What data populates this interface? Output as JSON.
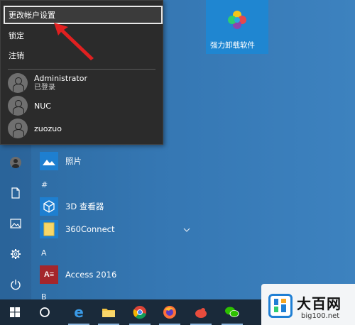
{
  "account_menu": {
    "change_account_settings": "更改帐户设置",
    "lock": "锁定",
    "sign_out": "注销",
    "users": [
      {
        "name": "Administrator",
        "status": "已登录"
      },
      {
        "name": "NUC",
        "status": ""
      },
      {
        "name": "zuozuo",
        "status": ""
      }
    ]
  },
  "tile": {
    "label": "强力卸载软件",
    "icon": "clover-icon"
  },
  "app_list": {
    "photos": "照片",
    "section_hash": "#",
    "viewer_3d": "3D 查看器",
    "connect_360": "360Connect",
    "section_a": "A",
    "access": "Access 2016",
    "section_b": "B"
  },
  "left_rail": {
    "icons": [
      "user-avatar-icon",
      "document-icon",
      "pictures-icon",
      "settings-icon",
      "power-icon"
    ]
  },
  "taskbar": {
    "icons": [
      "windows-start-icon",
      "cortana-icon",
      "edge-icon",
      "file-explorer-icon",
      "chrome-icon",
      "firefox-icon",
      "app-icon",
      "wechat-icon"
    ]
  },
  "watermark": {
    "title": "大百网",
    "url": "big100.net"
  },
  "colors": {
    "accent_tile": "#1f86d1",
    "popup_bg": "#2b2b2b",
    "arrow": "#e02020",
    "taskbar": "#1a2a3a"
  }
}
